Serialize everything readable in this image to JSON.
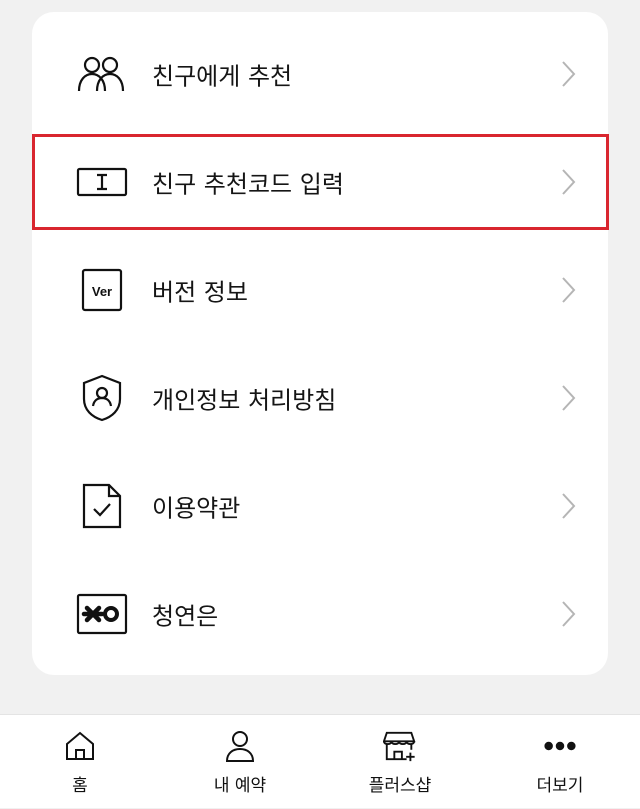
{
  "menu": {
    "items": [
      {
        "label": "친구에게 추천",
        "icon": "friends-icon"
      },
      {
        "label": "친구 추천코드 입력",
        "icon": "code-input-icon",
        "highlighted": true
      },
      {
        "label": "버전 정보",
        "icon": "version-icon",
        "icon_text": "Ver"
      },
      {
        "label": "개인정보 처리방침",
        "icon": "privacy-shield-icon"
      },
      {
        "label": "이용약관",
        "icon": "terms-document-icon"
      },
      {
        "label": "청연은",
        "icon": "brand-logo-icon"
      }
    ]
  },
  "tabbar": {
    "tabs": [
      {
        "label": "홈",
        "icon": "home-icon"
      },
      {
        "label": "내 예약",
        "icon": "person-icon"
      },
      {
        "label": "플러스샵",
        "icon": "shop-icon"
      },
      {
        "label": "더보기",
        "icon": "more-dots-icon"
      }
    ]
  },
  "colors": {
    "highlight_border": "#d9262f",
    "background": "#f1f1f1",
    "card": "#ffffff"
  }
}
